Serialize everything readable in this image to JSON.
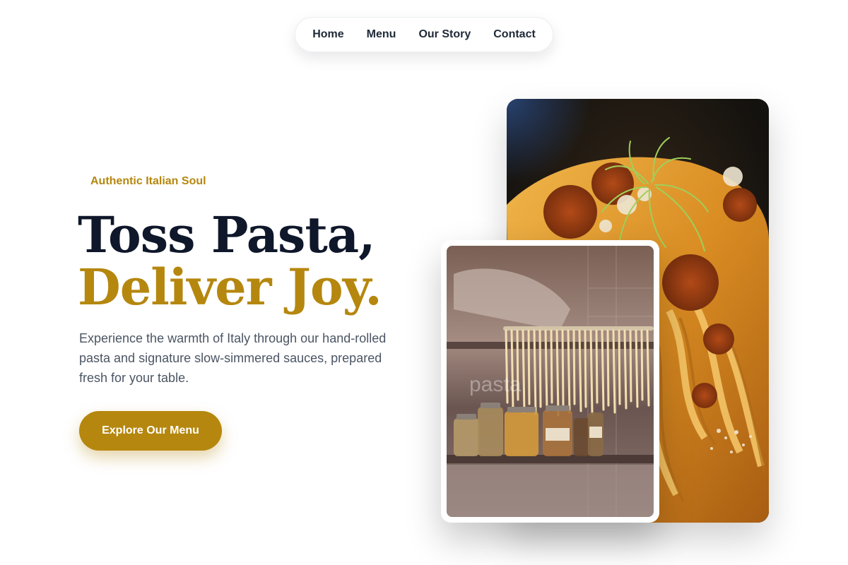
{
  "nav": {
    "items": [
      {
        "label": "Home"
      },
      {
        "label": "Menu"
      },
      {
        "label": "Our Story"
      },
      {
        "label": "Contact"
      }
    ]
  },
  "hero": {
    "eyebrow": "Authentic Italian Soul",
    "headline_line1": "Toss Pasta,",
    "headline_line2": "Deliver Joy.",
    "lead": "Experience the warmth of Italy through our hand-rolled pasta and signature slow-simmered sauces, prepared fresh for your table.",
    "cta_label": "Explore Our Menu"
  },
  "images": {
    "main": "pasta-dish-photo",
    "secondary": "fresh-pasta-drying-photo",
    "secondary_watermark": "pasta"
  },
  "colors": {
    "accent": "#b5870e",
    "heading": "#0f172a",
    "body_text": "#4b5563"
  }
}
